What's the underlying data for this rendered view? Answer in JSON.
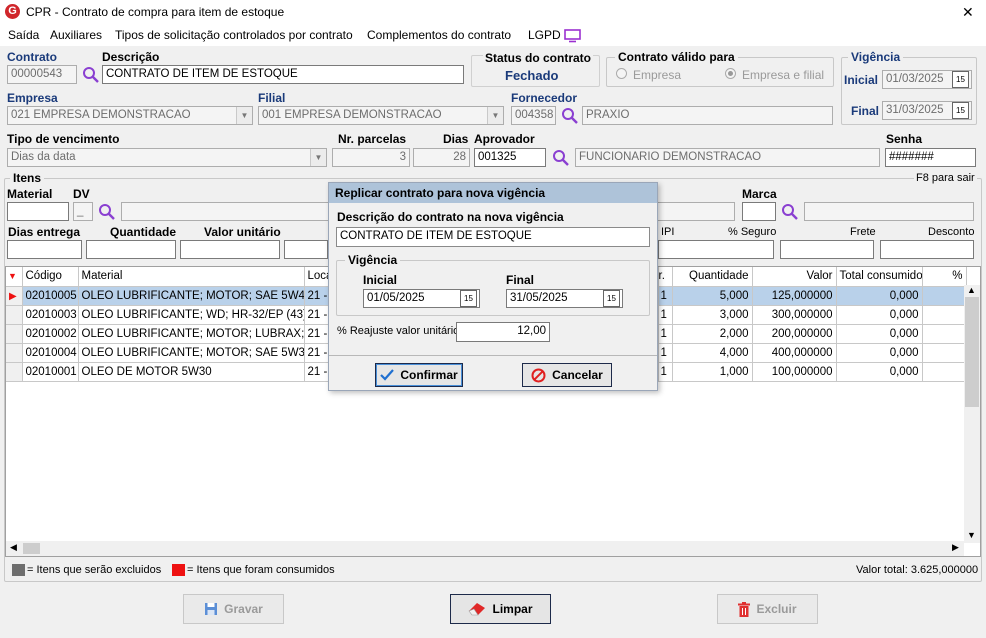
{
  "window": {
    "title": "CPR - Contrato de compra para item de estoque",
    "close": "✕"
  },
  "menu": [
    "Saída",
    "Auxiliares",
    "Tipos de solicitação controlados por contrato",
    "Complementos do contrato",
    "LGPD"
  ],
  "header": {
    "contrato_label": "Contrato",
    "contrato": "00000543",
    "descricao_label": "Descrição",
    "descricao": "CONTRATO DE ITEM DE ESTOQUE",
    "status_label": "Status do contrato",
    "status": "Fechado",
    "valido_label": "Contrato válido para",
    "valido_opt1": "Empresa",
    "valido_opt2": "Empresa e filial",
    "vigencia_label": "Vigência",
    "inicial_label": "Inicial",
    "inicial": "01/03/2025",
    "final_label": "Final",
    "final": "31/03/2025",
    "empresa_label": "Empresa",
    "empresa": "021 EMPRESA DEMONSTRACAO",
    "filial_label": "Filial",
    "filial": "001 EMPRESA DEMONSTRACAO",
    "fornecedor_label": "Fornecedor",
    "fornecedor_cod": "004358",
    "fornecedor": "PRAXIO",
    "tipo_venc_label": "Tipo de vencimento",
    "tipo_venc": "Dias da data",
    "nr_parcelas_label": "Nr. parcelas",
    "nr_parcelas": "3",
    "dias_label": "Dias",
    "dias": "28",
    "aprovador_label": "Aprovador",
    "aprovador_cod": "001325",
    "aprovador": "FUNCIONARIO DEMONSTRACAO",
    "senha_label": "Senha",
    "senha": "#######"
  },
  "itens": {
    "title": "Itens",
    "f8": "F8 para sair",
    "material_label": "Material",
    "dv_label": "DV",
    "dv": "_",
    "marca_label": "Marca",
    "dias_entrega_label": "Dias entrega",
    "quantidade_label": "Quantidade",
    "valor_unit_label": "Valor unitário",
    "ipi_label": "IPI",
    "seguro_label": "% Seguro",
    "frete_label": "Frete",
    "desconto_label": "Desconto"
  },
  "grid": {
    "headers": {
      "codigo": "Código",
      "material": "Material",
      "local": "Loca",
      "fr": "r.",
      "quantidade": "Quantidade",
      "valor": "Valor",
      "consumido": "Total consumido",
      "pct": "%"
    },
    "rows": [
      {
        "codigo": "02010005",
        "material": "OLEO LUBRIFICANTE; MOTOR; SAE 5W4...",
        "local": "21 -",
        "fr": "1",
        "quantidade": "5,000",
        "valor": "125,000000",
        "consumido": "0,000"
      },
      {
        "codigo": "02010003",
        "material": "OLEO LUBRIFICANTE; WD; HR-32/EP (43)",
        "local": "21 -",
        "fr": "1",
        "quantidade": "3,000",
        "valor": "300,000000",
        "consumido": "0,000"
      },
      {
        "codigo": "02010002",
        "material": "OLEO LUBRIFICANTE; MOTOR; LUBRAX; ...",
        "local": "21 -",
        "fr": "1",
        "quantidade": "2,000",
        "valor": "200,000000",
        "consumido": "0,000"
      },
      {
        "codigo": "02010004",
        "material": "OLEO LUBRIFICANTE; MOTOR; SAE 5W3...",
        "local": "21 -",
        "fr": "1",
        "quantidade": "4,000",
        "valor": "400,000000",
        "consumido": "0,000"
      },
      {
        "codigo": "02010001",
        "material": "OLEO DE MOTOR 5W30",
        "local": "21 -",
        "fr": "1",
        "quantidade": "1,000",
        "valor": "100,000000",
        "consumido": "0,000"
      }
    ]
  },
  "legend": {
    "gray": "= Itens que serão excluidos",
    "red": "= Itens que foram consumidos",
    "total": "Valor total: 3.625,000000",
    "gray_color": "#6e6e6e",
    "red_color": "#ee1111"
  },
  "buttons": {
    "gravar": "Gravar",
    "limpar": "Limpar",
    "excluir": "Excluir"
  },
  "dialog": {
    "title": "Replicar contrato para nova vigência",
    "desc_label": "Descrição do contrato na nova vigência",
    "desc": "CONTRATO DE ITEM DE ESTOQUE",
    "vigencia_label": "Vigência",
    "inicial_label": "Inicial",
    "inicial": "01/05/2025",
    "final_label": "Final",
    "final": "31/05/2025",
    "reajuste_label": "% Reajuste valor unitário",
    "reajuste": "12,00",
    "confirmar": "Confirmar",
    "cancelar": "Cancelar"
  }
}
